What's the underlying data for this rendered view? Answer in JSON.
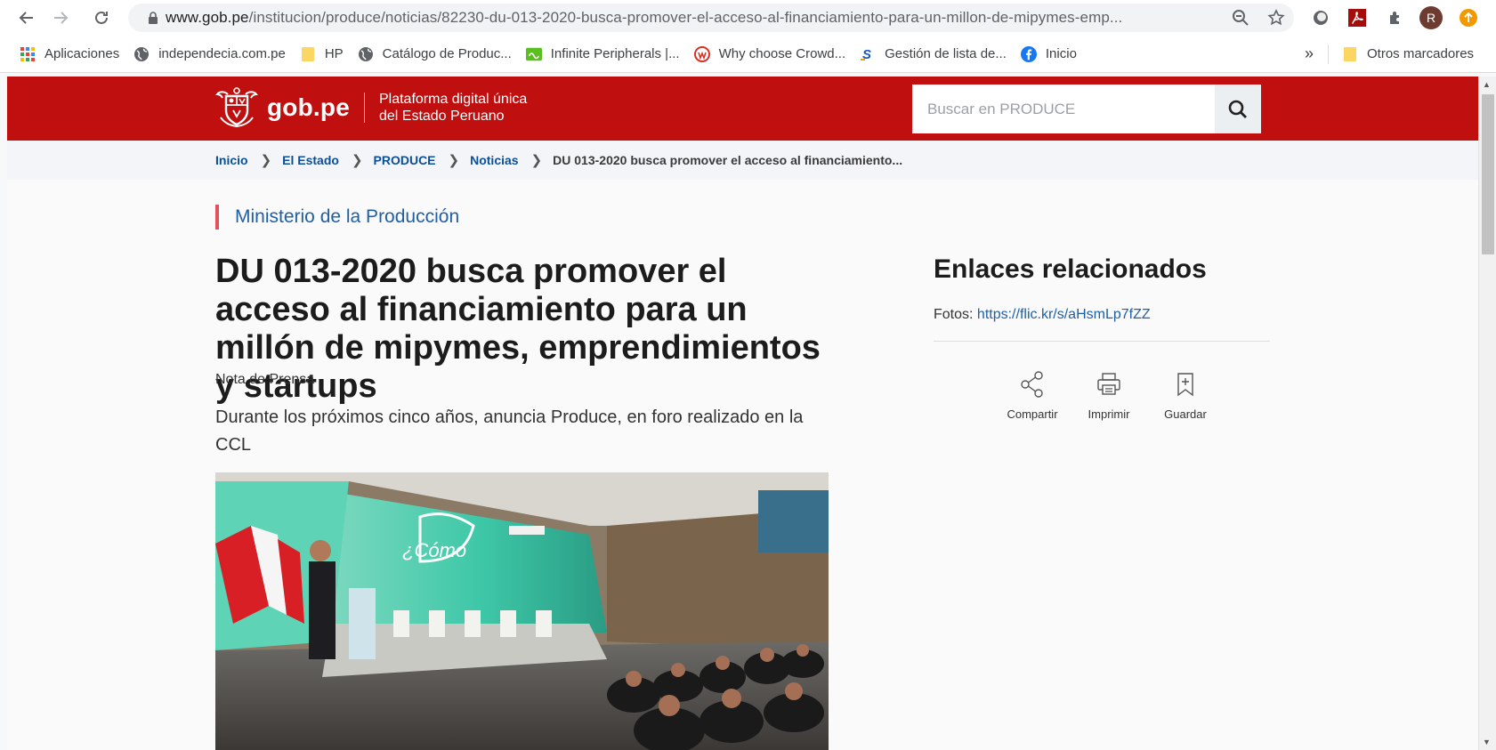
{
  "browser": {
    "url_domain": "www.gob.pe",
    "url_path": "/institucion/produce/noticias/82230-du-013-2020-busca-promover-el-acceso-al-financiamiento-para-un-millon-de-mipymes-emp...",
    "profile_initial": "R",
    "bookmarks": [
      {
        "label": "Aplicaciones",
        "icon": "apps-grid-icon"
      },
      {
        "label": "independecia.com.pe",
        "icon": "globe-icon"
      },
      {
        "label": "HP",
        "icon": "folder-icon"
      },
      {
        "label": "Catálogo de Produc...",
        "icon": "globe-icon"
      },
      {
        "label": "Infinite Peripherals |...",
        "icon": "infinite-peripherals-icon"
      },
      {
        "label": "Why choose Crowd...",
        "icon": "crowd-icon"
      },
      {
        "label": "Gestión de lista de...",
        "icon": "s-logo-icon"
      },
      {
        "label": "Inicio",
        "icon": "facebook-icon"
      }
    ],
    "more_bookmarks": "»",
    "other_bookmarks": "Otros marcadores"
  },
  "site": {
    "logo_text": "gob.pe",
    "tagline_line1": "Plataforma digital única",
    "tagline_line2": "del Estado Peruano",
    "search_placeholder": "Buscar en PRODUCE"
  },
  "breadcrumb": [
    {
      "label": "Inicio"
    },
    {
      "label": "El Estado"
    },
    {
      "label": "PRODUCE"
    },
    {
      "label": "Noticias"
    },
    {
      "label": "DU 013-2020 busca promover el acceso al financiamiento..."
    }
  ],
  "article": {
    "institution": "Ministerio de la Producción",
    "title": "DU 013-2020 busca promover el acceso al financiamiento para un millón de mipymes, emprendimientos y startups",
    "type": "Nota de Prensa",
    "lead": "Durante los próximos cinco años, anuncia Produce, en foro realizado en la CCL"
  },
  "aside": {
    "heading": "Enlaces relacionados",
    "photos_label": "Fotos:",
    "photos_link": "https://flic.kr/s/aHsmLp7fZZ",
    "actions": {
      "share": "Compartir",
      "print": "Imprimir",
      "save": "Guardar"
    }
  },
  "colors": {
    "gob_red": "#c00f0f",
    "link_blue": "#1f5fa5",
    "accent_bar": "#e5505a"
  }
}
